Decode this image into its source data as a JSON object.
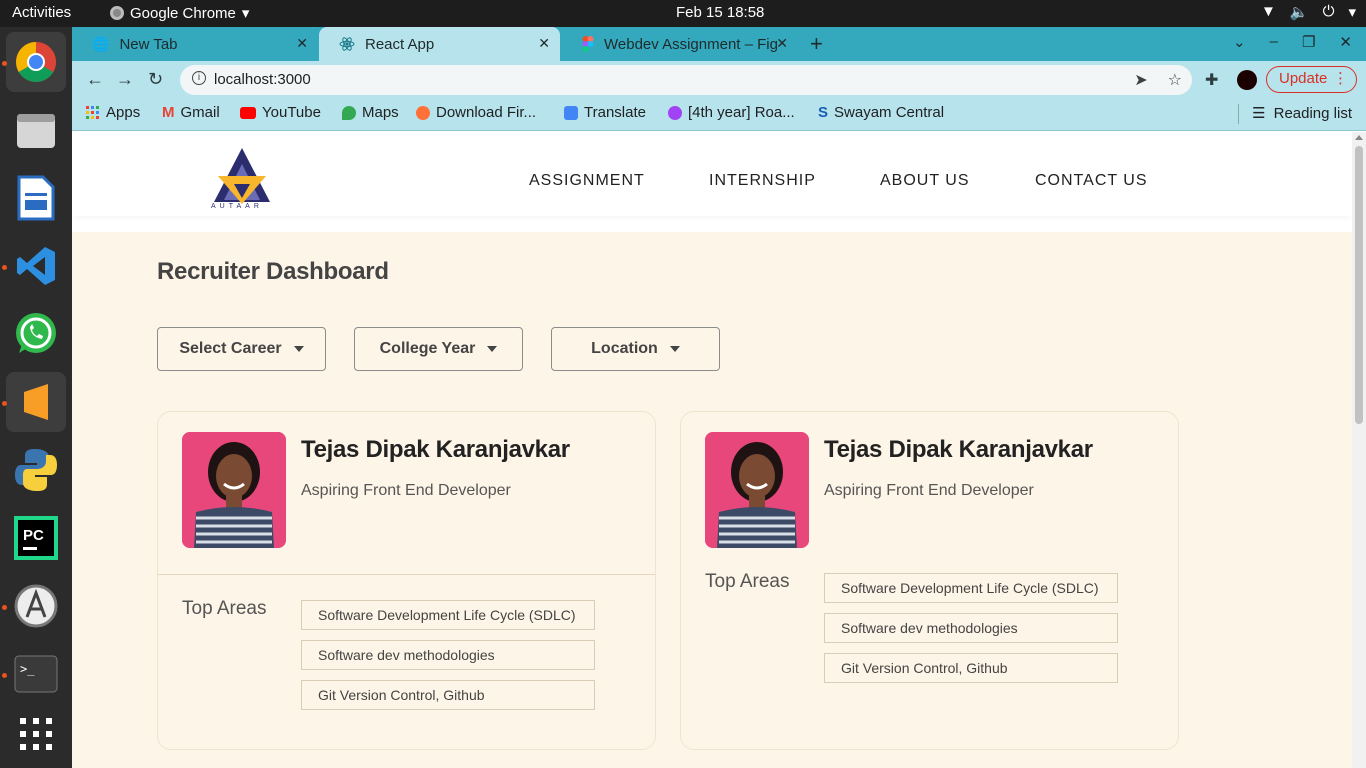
{
  "system": {
    "activities": "Activities",
    "app_name": "Google Chrome",
    "clock": "Feb 15  18:58"
  },
  "dock": {
    "apps": [
      "chrome-icon",
      "files-icon",
      "writer-icon",
      "vscode-icon",
      "whatsapp-icon",
      "sublime-icon",
      "python-icon",
      "pycharm-icon",
      "software-updater-icon",
      "terminal-icon",
      "app-grid-icon"
    ]
  },
  "browser": {
    "tabs": [
      {
        "title": "New Tab",
        "active": false
      },
      {
        "title": "React App",
        "active": true
      },
      {
        "title": "Webdev Assignment – Fig",
        "active": false
      }
    ],
    "url": "localhost:3000",
    "update_label": "Update",
    "bookmarks": [
      "Apps",
      "Gmail",
      "YouTube",
      "Maps",
      "Download Fir...",
      "Translate",
      "[4th year] Roa...",
      "Swayam Central"
    ],
    "reading_list": "Reading list"
  },
  "site": {
    "logo_text": "AUTAAR",
    "nav": [
      "ASSIGNMENT",
      "INTERNSHIP",
      "ABOUT US",
      "CONTACT US"
    ],
    "page_title": "Recruiter Dashboard",
    "filters": [
      "Select Career",
      "College Year",
      "Location"
    ],
    "cards": [
      {
        "name": "Tejas Dipak Karanjavkar",
        "role": "Aspiring Front End Developer",
        "areas_label": "Top Areas",
        "areas": [
          "Software Development Life Cycle (SDLC)",
          "Software dev methodologies",
          "Git Version Control, Github"
        ]
      },
      {
        "name": "Tejas Dipak Karanjavkar",
        "role": "Aspiring Front End Developer",
        "areas_label": "Top Areas",
        "areas": [
          "Software Development Life Cycle (SDLC)",
          "Software dev methodologies",
          "Git Version Control, Github"
        ]
      }
    ]
  },
  "colors": {
    "page_bg": "#fdf5e7",
    "tab_strip": "#34a9bd",
    "toolbar": "#b7e4ec",
    "update_red": "#d93025"
  }
}
